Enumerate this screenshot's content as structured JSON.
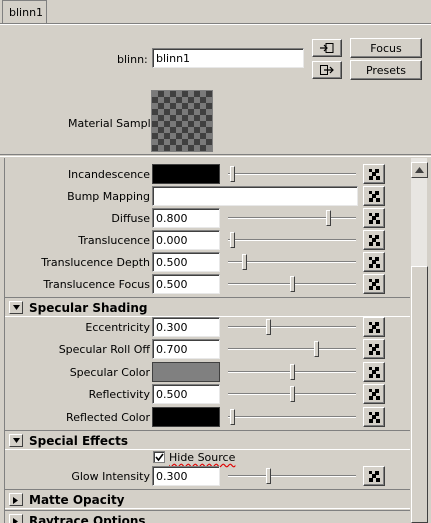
{
  "tab": {
    "label": "blinn1"
  },
  "header": {
    "name_label": "blinn:",
    "name_value": "blinn1",
    "focus_label": "Focus",
    "presets_label": "Presets",
    "sample_label": "Material Sample"
  },
  "rows_top": {
    "incandescence": {
      "label": "Incandescence",
      "color": "#000000",
      "slider": 0.0
    },
    "bump": {
      "label": "Bump Mapping"
    },
    "diffuse": {
      "label": "Diffuse",
      "value": "0.800",
      "slider": 0.8
    },
    "translucence": {
      "label": "Translucence",
      "value": "0.000",
      "slider": 0.0
    },
    "trans_depth": {
      "label": "Translucence Depth",
      "value": "0.500",
      "slider": 0.1
    },
    "trans_focus": {
      "label": "Translucence Focus",
      "value": "0.500",
      "slider": 0.5
    }
  },
  "specular": {
    "title": "Specular Shading",
    "eccentricity": {
      "label": "Eccentricity",
      "value": "0.300",
      "slider": 0.3
    },
    "rolloff": {
      "label": "Specular Roll Off",
      "value": "0.700",
      "slider": 0.7
    },
    "color": {
      "label": "Specular Color",
      "color": "#808080",
      "slider": 0.5
    },
    "reflectivity": {
      "label": "Reflectivity",
      "value": "0.500",
      "slider": 0.5
    },
    "reflected": {
      "label": "Reflected Color",
      "color": "#000000",
      "slider": 0.0
    }
  },
  "special": {
    "title": "Special Effects",
    "hide_source": "Hide Source",
    "glow": {
      "label": "Glow Intensity",
      "value": "0.300",
      "slider": 0.3
    }
  },
  "collapsed": {
    "matte": "Matte Opacity",
    "raytrace": "Raytrace Options"
  }
}
